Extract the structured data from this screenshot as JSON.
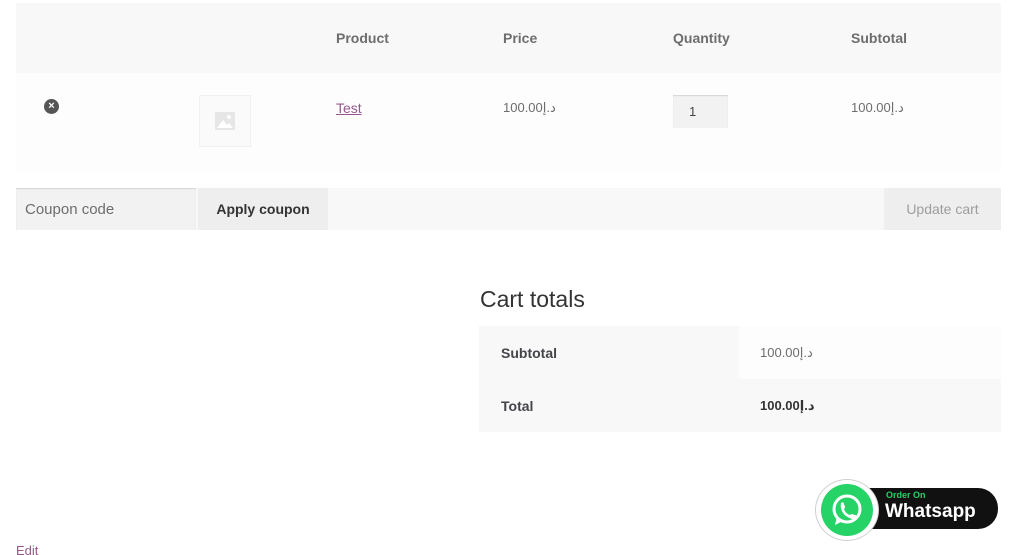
{
  "cart_table": {
    "headers": {
      "product": "Product",
      "price": "Price",
      "quantity": "Quantity",
      "subtotal": "Subtotal"
    },
    "items": [
      {
        "name": "Test",
        "price": "100.00د.إ",
        "quantity": "1",
        "subtotal": "100.00د.إ",
        "remove_symbol": "×"
      }
    ]
  },
  "actions": {
    "coupon_placeholder": "Coupon code",
    "apply_label": "Apply coupon",
    "update_label": "Update cart"
  },
  "cart_totals": {
    "heading": "Cart totals",
    "subtotal_label": "Subtotal",
    "subtotal_value": "100.00د.إ",
    "total_label": "Total",
    "total_value": "100.00د.إ"
  },
  "whatsapp": {
    "small_text": "Order On",
    "big_text": "Whatsapp",
    "color": "#25d366"
  },
  "footer": {
    "edit_label": "Edit"
  },
  "colors": {
    "link": "#96588a",
    "header_bg": "#f8f8f8",
    "muted_text": "#6d6d6d"
  }
}
